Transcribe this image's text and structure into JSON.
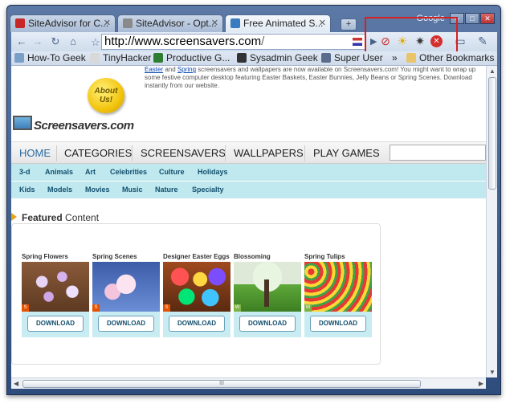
{
  "window": {
    "google_label": "Google",
    "controls": [
      "–",
      "□",
      "✕"
    ]
  },
  "tabs": [
    {
      "title": "SiteAdvisor for C...",
      "favicon_color": "#c62828"
    },
    {
      "title": "SiteAdvisor - Opt...",
      "favicon_color": "#8a8a8a"
    },
    {
      "title": "Free Animated S...",
      "favicon_color": "#3a7bbf"
    }
  ],
  "toolbar": {
    "url_prefix": "http://",
    "url_host": "www.screensavers.com",
    "url_rest": "/",
    "icons": [
      "back-icon",
      "forward-icon",
      "reload-icon",
      "home-icon",
      "bookmark-star-icon"
    ],
    "extensions": [
      "siteadvisor-icon",
      "weather-icon",
      "brightness-icon",
      "red-x-icon"
    ]
  },
  "bookmarks": [
    {
      "label": "How-To Geek",
      "color": "#7aa0c8"
    },
    {
      "label": "TinyHacker",
      "color": "#d9d9d9"
    },
    {
      "label": "Productive G...",
      "color": "#2e7d32"
    },
    {
      "label": "Sysadmin Geek",
      "color": "#333333"
    },
    {
      "label": "Super User",
      "color": "#5a6b8c"
    }
  ],
  "bookmarks_more": "»",
  "other_bookmarks": "Other Bookmarks",
  "page": {
    "about_us": "About Us!",
    "logo_text": "Screensavers.com",
    "promo_link1": "Easter",
    "promo_and": " and ",
    "promo_link2": "Spring",
    "promo_text": " screensavers and wallpapers are now available on Screensavers.com! You might want to wrap up some festive computer desktop featuring Easter Baskets, Easter Bunnies, Jelly Beans or Spring Scenes. Download instantly from our website.",
    "nav": [
      "HOME",
      "CATEGORIES",
      "SCREENSAVERS",
      "WALLPAPERS",
      "PLAY GAMES"
    ],
    "subnav1": [
      "3-d",
      "Animals",
      "Art",
      "Celebrities",
      "Culture",
      "Holidays"
    ],
    "subnav2": [
      "Kids",
      "Models",
      "Movies",
      "Music",
      "Nature",
      "Specialty"
    ],
    "featured_bold": "Featured",
    "featured_rest": " Content",
    "cards": [
      {
        "title": "Spring Flowers",
        "badge": "S",
        "download": "DOWNLOAD"
      },
      {
        "title": "Spring Scenes",
        "badge": "S",
        "download": "DOWNLOAD"
      },
      {
        "title": "Designer Easter Eggs",
        "badge": "S",
        "download": "DOWNLOAD"
      },
      {
        "title": "Blossoming",
        "badge": "W",
        "download": "DOWNLOAD"
      },
      {
        "title": "Spring Tulips",
        "badge": "W",
        "download": "DOWNLOAD"
      }
    ]
  },
  "scroll": {
    "grip": "III"
  }
}
